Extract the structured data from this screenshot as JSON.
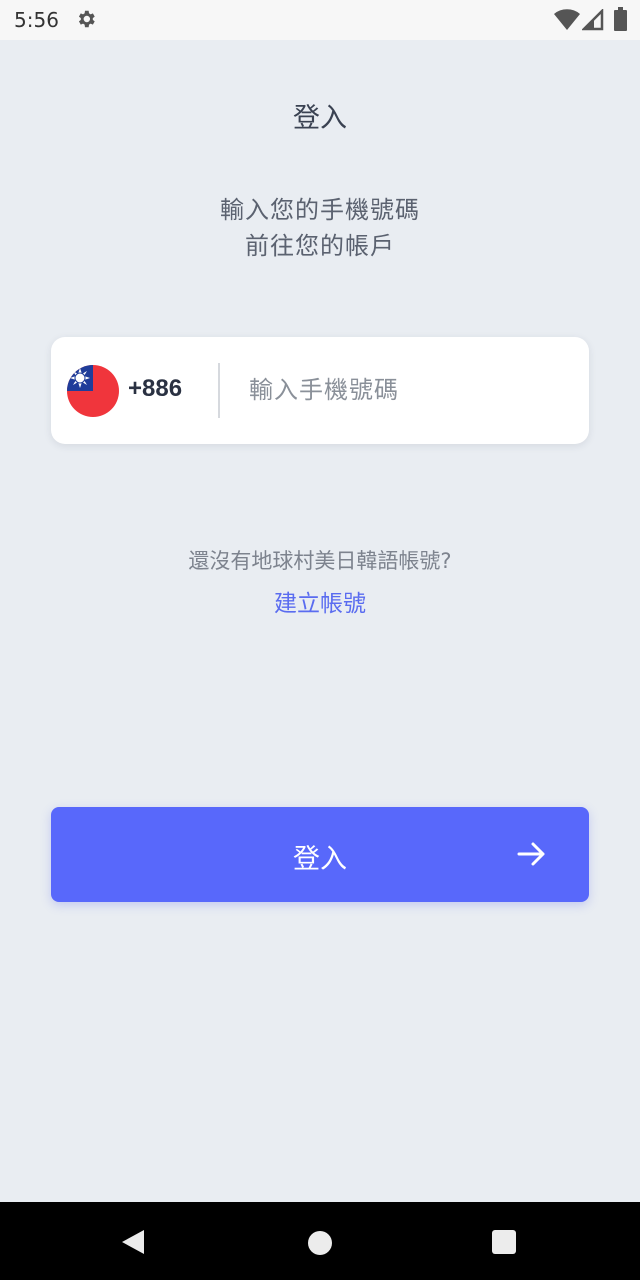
{
  "status_bar": {
    "time": "5:56",
    "icons": [
      "gear-icon",
      "wifi-icon",
      "signal-icon",
      "battery-icon"
    ]
  },
  "login": {
    "title": "登入",
    "subtitle_line1": "輸入您的手機號碼",
    "subtitle_line2": "前往您的帳戶",
    "country_flag": "taiwan-flag-icon",
    "country_code": "+886",
    "phone_placeholder": "輸入手機號碼",
    "no_account_text": "還沒有地球村美日韓語帳號?",
    "create_account_link": "建立帳號",
    "submit_label": "登入",
    "submit_icon": "arrow-right-icon"
  },
  "colors": {
    "background": "#e9edf2",
    "accent": "#5868fb",
    "link": "#5a6cf0",
    "title_text": "#3a4252"
  },
  "nav_bar": {
    "icons": [
      "back-icon",
      "home-icon",
      "recents-icon"
    ]
  }
}
